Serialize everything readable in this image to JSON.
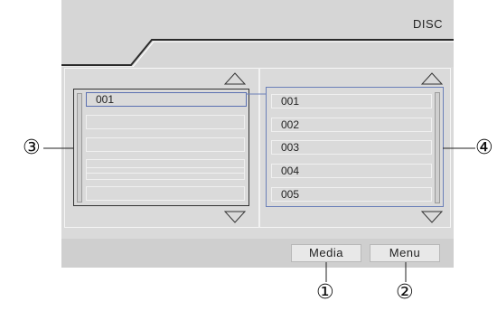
{
  "header": {
    "title": "DISC"
  },
  "left_list": {
    "items": [
      "001",
      "",
      "",
      "",
      "",
      ""
    ]
  },
  "right_list": {
    "items": [
      "001",
      "002",
      "003",
      "004",
      "005"
    ]
  },
  "footer": {
    "media_label": "Media",
    "menu_label": "Menu"
  },
  "callouts": {
    "media": "①",
    "menu": "②",
    "left_panel": "③",
    "right_panel": "④"
  },
  "icons": {
    "left_up": "triangle-up-icon",
    "left_down": "triangle-down-icon",
    "right_up": "triangle-up-icon",
    "right_down": "triangle-down-icon"
  }
}
